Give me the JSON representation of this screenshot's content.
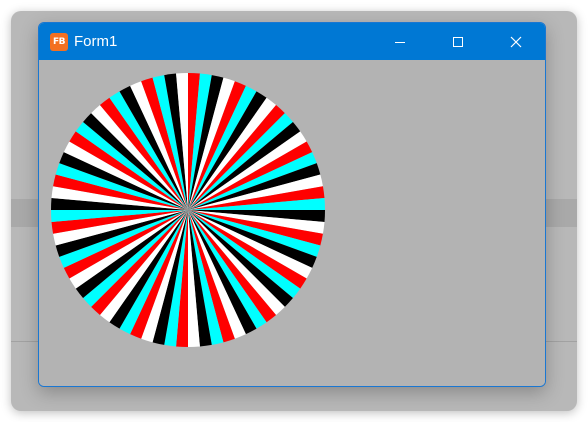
{
  "window": {
    "title": "Form1",
    "icon": {
      "name": "fb-app-icon",
      "text": "FB",
      "color": "#f37021"
    },
    "titlebar_color": "#0078d4",
    "client_color": "#b3b3b3",
    "controls": [
      {
        "name": "minimize-button",
        "icon": "minimize-icon"
      },
      {
        "name": "maximize-button",
        "icon": "maximize-icon"
      },
      {
        "name": "close-button",
        "icon": "close-icon"
      }
    ]
  },
  "canvas": {
    "drawing": "radial-striped-wheel",
    "stripe_colors": [
      "#ff0000",
      "#00ffff",
      "#000000",
      "#ffffff"
    ],
    "stripe_count": 72
  },
  "backdrop": {
    "color": "#b8b8b8"
  }
}
